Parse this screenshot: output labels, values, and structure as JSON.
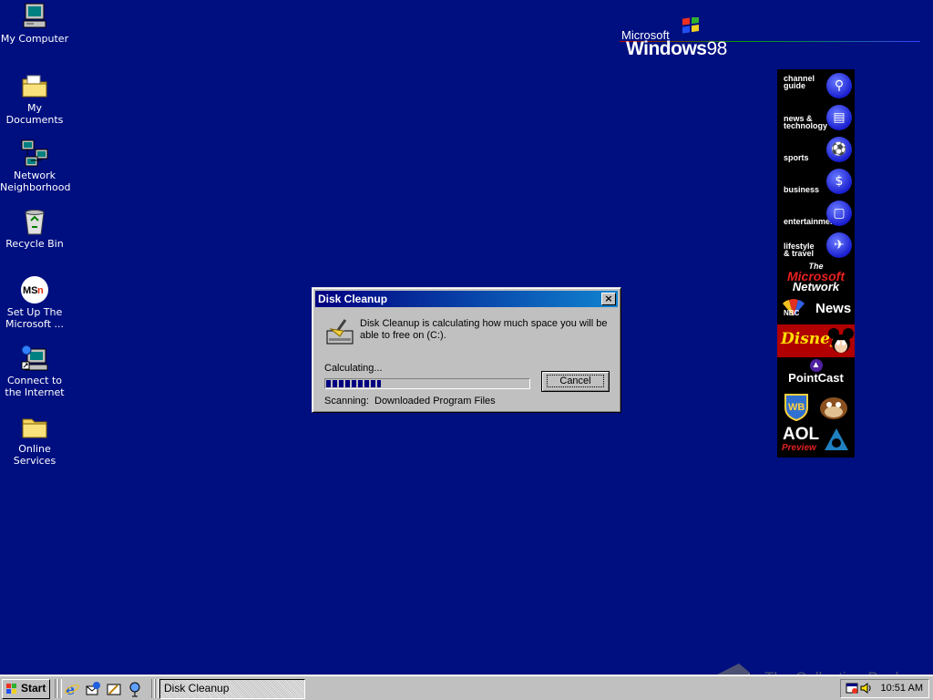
{
  "desktop": {
    "icons": [
      {
        "label": "My Computer",
        "icon": "computer-icon"
      },
      {
        "label": "My Documents",
        "icon": "folder-documents-icon"
      },
      {
        "label": "Network Neighborhood",
        "icon": "network-icon"
      },
      {
        "label": "Recycle Bin",
        "icon": "recycle-bin-icon"
      },
      {
        "label": "Set Up The Microsoft ...",
        "icon": "msn-icon"
      },
      {
        "label": "Connect to the Internet",
        "icon": "connect-internet-icon"
      },
      {
        "label": "Online Services",
        "icon": "folder-icon"
      }
    ]
  },
  "logo": {
    "microsoft": "Microsoft",
    "windows": "Windows",
    "version": "98"
  },
  "channel_bar": {
    "channels": [
      {
        "label": "channel\nguide",
        "icon": "magnifier-icon"
      },
      {
        "label": "news &\ntechnology",
        "icon": "newspaper-icon"
      },
      {
        "label": "sports",
        "icon": "soccer-ball-icon"
      },
      {
        "label": "business",
        "icon": "dollar-icon"
      },
      {
        "label": "entertainment",
        "icon": "tv-icon"
      },
      {
        "label": "lifestyle\n& travel",
        "icon": "airplane-icon"
      }
    ],
    "msn_line1": "The",
    "msn_line2": "Microsoft",
    "msn_line3": "Network",
    "msnbc": "News",
    "disney": "Disney",
    "pointcast": "PointCast",
    "wb": "WB",
    "aol": "AOL",
    "aol_preview": "Preview"
  },
  "dialog": {
    "title": "Disk Cleanup",
    "close_glyph": "×",
    "message": "Disk Cleanup is calculating how much space you will be able to free on  (C:).",
    "calculating_label": "Calculating...",
    "progress": 0.27,
    "cancel_label": "Cancel",
    "scanning_label": "Scanning:",
    "scanning_value": "Downloaded Program Files"
  },
  "taskbar": {
    "start_label": "Start",
    "quick_launch": [
      "internet-explorer-icon",
      "outlook-express-icon",
      "show-desktop-icon",
      "view-channels-icon"
    ],
    "task_button": "Disk Cleanup",
    "clock": "10:51 AM",
    "tray_icons": [
      "scheduler-icon",
      "volume-icon"
    ]
  },
  "watermark": {
    "text": "The Collection Book"
  },
  "colors": {
    "desktop": "#000f80",
    "titlebar_start": "#000080",
    "titlebar_end": "#1084d0",
    "face": "#c0c0c0"
  }
}
